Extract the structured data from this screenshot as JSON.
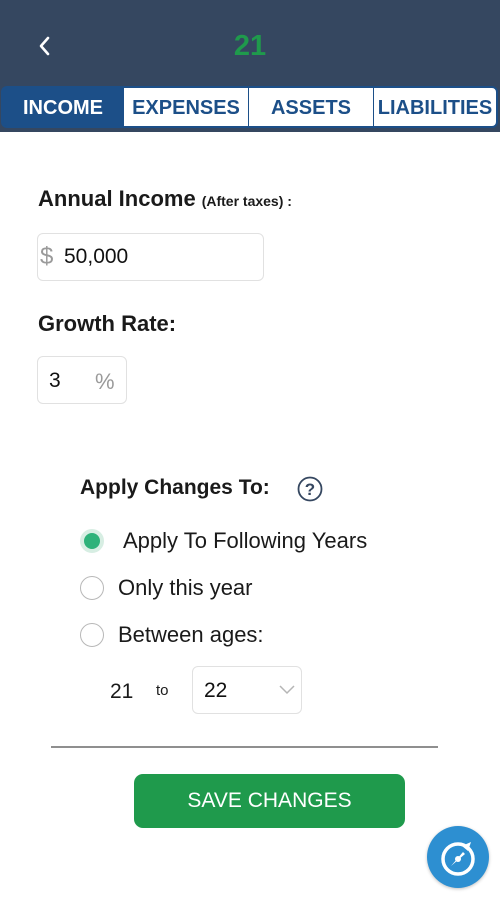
{
  "header": {
    "title": "21"
  },
  "tabs": [
    {
      "label": "INCOME",
      "active": true
    },
    {
      "label": "EXPENSES",
      "active": false
    },
    {
      "label": "ASSETS",
      "active": false
    },
    {
      "label": "LIABILITIES",
      "active": false
    }
  ],
  "income": {
    "label": "Annual Income",
    "sublabel": "(After taxes) :",
    "currency_symbol": "$",
    "value": "50,000"
  },
  "growth": {
    "label": "Growth Rate:",
    "value": "3",
    "unit": "%"
  },
  "apply": {
    "label": "Apply Changes To:",
    "help_icon": "question-circle-icon",
    "options": [
      {
        "label": "Apply To Following Years",
        "checked": true
      },
      {
        "label": "Only this year",
        "checked": false
      },
      {
        "label": "Between ages:",
        "checked": false
      }
    ],
    "age_from": "21",
    "age_to_label": "to",
    "age_to": "22"
  },
  "save_button": {
    "label": "SAVE CHANGES"
  },
  "colors": {
    "header_bg": "#354760",
    "tab_blue": "#1c4f88",
    "accent_green": "#1f9a4c",
    "radio_green": "#2eb27a",
    "fab_blue": "#2d8fd1"
  }
}
